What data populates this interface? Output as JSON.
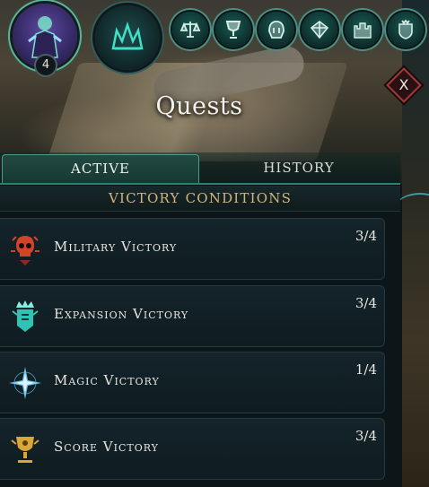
{
  "player": {
    "level": "4"
  },
  "menu_icons": [
    "scales-icon",
    "chalice-icon",
    "helmet-icon",
    "gem-icon",
    "castle-icon",
    "crown-shield-icon"
  ],
  "panel": {
    "title": "Quests",
    "close_label": "X"
  },
  "tabs": [
    {
      "label": "ACTIVE",
      "selected": true
    },
    {
      "label": "HISTORY",
      "selected": false
    }
  ],
  "section": {
    "header": "VICTORY CONDITIONS"
  },
  "quests": [
    {
      "name": "Military Victory",
      "progress": "3/4",
      "icon": "red-skull-icon",
      "color": "#d2432c"
    },
    {
      "name": "Expansion Victory",
      "progress": "3/4",
      "icon": "teal-crown-banner-icon",
      "color": "#2fc3b4"
    },
    {
      "name": "Magic Victory",
      "progress": "1/4",
      "icon": "blue-star-icon",
      "color": "#6fc6f0"
    },
    {
      "name": "Score Victory",
      "progress": "3/4",
      "icon": "gold-chalice-icon",
      "color": "#d8a737"
    }
  ],
  "colors": {
    "accent_teal": "#2c8270",
    "section_gold": "#d5b37b",
    "close_red": "#a23b3b"
  }
}
